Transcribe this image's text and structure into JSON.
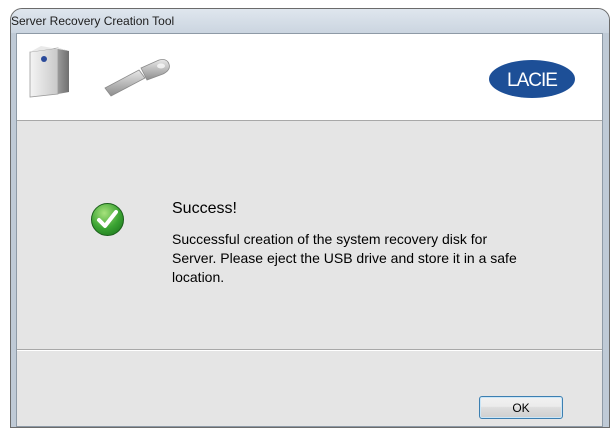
{
  "window": {
    "title": "Server Recovery Creation Tool"
  },
  "banner": {
    "icons": [
      "server-drive-icon",
      "usb-key-icon"
    ],
    "logo_text": "LACIE",
    "logo_color": "#1d4f97"
  },
  "message": {
    "icon": "checkmark-icon",
    "icon_color": "#3aa332",
    "title": "Success!",
    "body": "Successful creation of the system recovery disk for Server. Please eject the USB drive and store it in a safe location."
  },
  "footer": {
    "ok_label": "OK"
  }
}
